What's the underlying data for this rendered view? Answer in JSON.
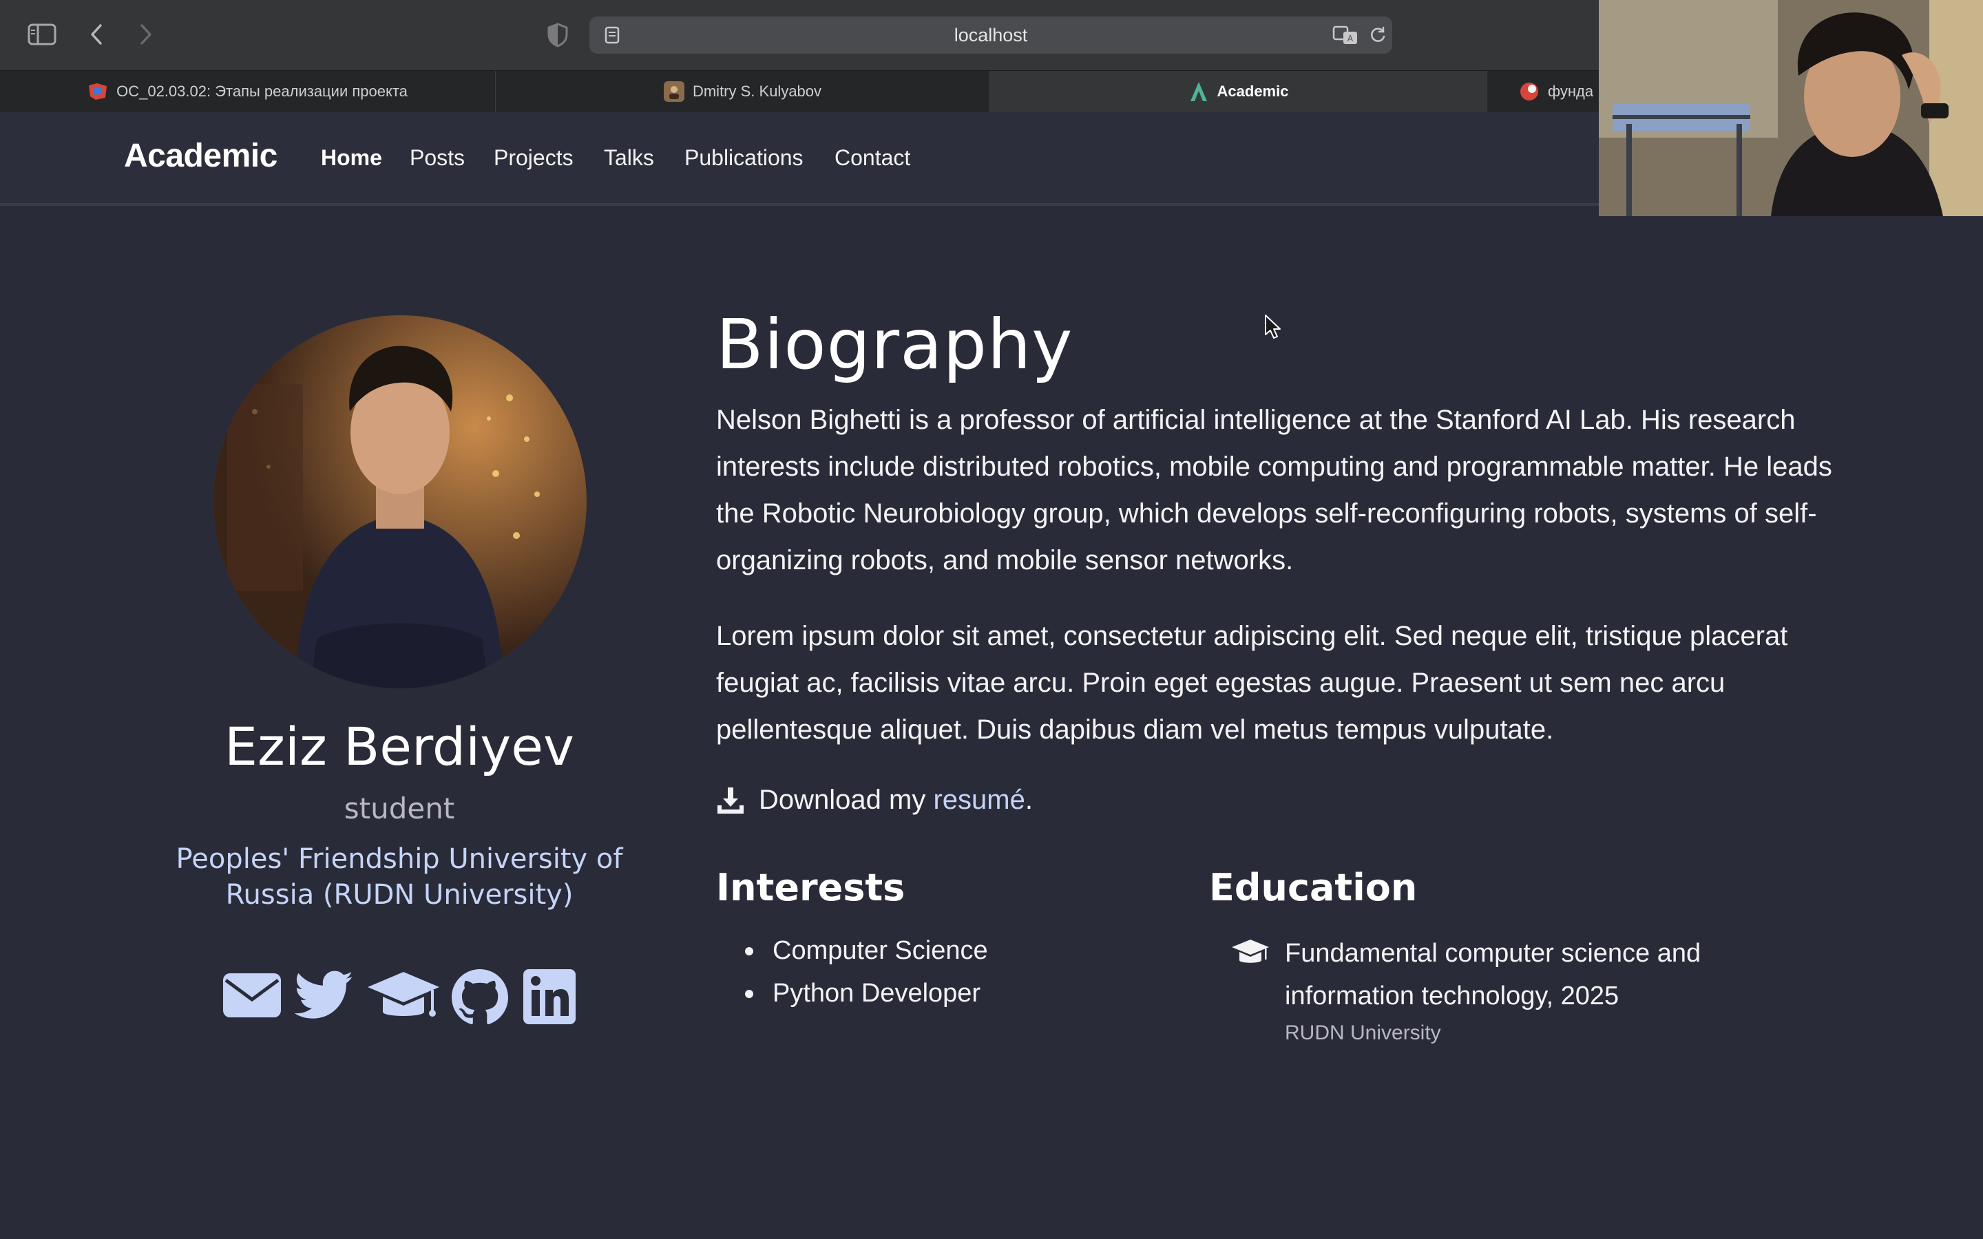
{
  "browser": {
    "url": "localhost",
    "tabs": [
      {
        "title": "ОС_02.03.02: Этапы реализации проекта",
        "active": false
      },
      {
        "title": "Dmitry S. Kulyabov",
        "active": false
      },
      {
        "title": "Academic",
        "active": true
      },
      {
        "title": "фунда",
        "active": false
      }
    ]
  },
  "site": {
    "brand": "Academic",
    "nav": [
      "Home",
      "Posts",
      "Projects",
      "Talks",
      "Publications",
      "Contact"
    ]
  },
  "profile": {
    "name": "Eziz Berdiyev",
    "role": "student",
    "organization": "Peoples' Friendship University of Russia (RUDN University)",
    "social_icons": [
      "envelope-icon",
      "twitter-icon",
      "graduation-cap-icon",
      "github-icon",
      "linkedin-icon"
    ]
  },
  "biography": {
    "title": "Biography",
    "paragraphs": [
      "Nelson Bighetti is a professor of artificial intelligence at the Stanford AI Lab. His research interests include distributed robotics, mobile computing and programmable matter. He leads the Robotic Neurobiology group, which develops self-reconfiguring robots, systems of self-organizing robots, and mobile sensor networks.",
      "Lorem ipsum dolor sit amet, consectetur adipiscing elit. Sed neque elit, tristique placerat feugiat ac, facilisis vitae arcu. Proin eget egestas augue. Praesent ut sem nec arcu pellentesque aliquet. Duis dapibus diam vel metus tempus vulputate."
    ],
    "download_prefix": "Download my ",
    "download_link": "resumé",
    "download_suffix": "."
  },
  "interests": {
    "title": "Interests",
    "items": [
      "Computer Science",
      "Python Developer"
    ]
  },
  "education": {
    "title": "Education",
    "items": [
      {
        "degree": "Fundamental computer science and information technology, 2025",
        "institution": "RUDN University"
      }
    ]
  },
  "colors": {
    "page_bg": "#2a2b38",
    "accent_link": "#c5d4f7"
  }
}
